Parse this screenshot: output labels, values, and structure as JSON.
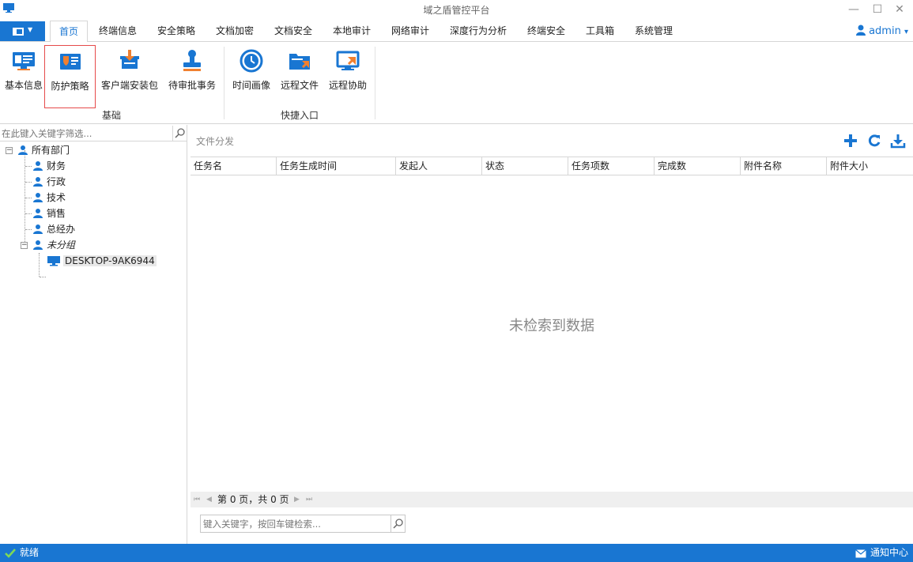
{
  "window": {
    "title": "域之盾管控平台",
    "min_glyph": "—",
    "max_glyph": "☐",
    "close_glyph": "✕"
  },
  "menu": {
    "tabs": [
      {
        "label": "首页",
        "active": true
      },
      {
        "label": "终端信息"
      },
      {
        "label": "安全策略"
      },
      {
        "label": "文档加密"
      },
      {
        "label": "文档安全"
      },
      {
        "label": "本地审计"
      },
      {
        "label": "网络审计"
      },
      {
        "label": "深度行为分析"
      },
      {
        "label": "终端安全"
      },
      {
        "label": "工具箱"
      },
      {
        "label": "系统管理"
      }
    ],
    "user": "admin",
    "user_caret": "▾"
  },
  "ribbon": {
    "groups": [
      {
        "label": "基础",
        "buttons": [
          {
            "label": "基本信息",
            "icon": "monitor-info-icon"
          },
          {
            "label": "防护策略",
            "icon": "shield-policy-icon",
            "selected": true
          },
          {
            "label": "客户端安装包",
            "icon": "install-package-icon"
          },
          {
            "label": "待审批事务",
            "icon": "approval-stamp-icon"
          }
        ]
      },
      {
        "label": "快捷入口",
        "buttons": [
          {
            "label": "时间画像",
            "icon": "clock-icon"
          },
          {
            "label": "远程文件",
            "icon": "remote-folder-icon"
          },
          {
            "label": "远程协助",
            "icon": "remote-assist-icon"
          }
        ]
      }
    ]
  },
  "sidebar": {
    "filter_placeholder": "在此键入关键字筛选...",
    "tree": {
      "root": "所有部门",
      "departments": [
        "财务",
        "行政",
        "技术",
        "销售",
        "总经办"
      ],
      "ungrouped": "未分组",
      "computer": "DESKTOP-9AK6944"
    }
  },
  "main": {
    "title": "文件分发",
    "columns": [
      "任务名",
      "任务生成时间",
      "发起人",
      "状态",
      "任务项数",
      "完成数",
      "附件名称",
      "附件大小"
    ],
    "empty_text": "未检索到数据",
    "pager_text": "第 0 页，共 0 页",
    "search_placeholder": "键入关键字，按回车键检索..."
  },
  "status": {
    "ready": "就绪",
    "notify": "通知中心"
  },
  "colors": {
    "accent": "#1976d2",
    "selected_border": "#e64a4a",
    "orange": "#f08030"
  }
}
